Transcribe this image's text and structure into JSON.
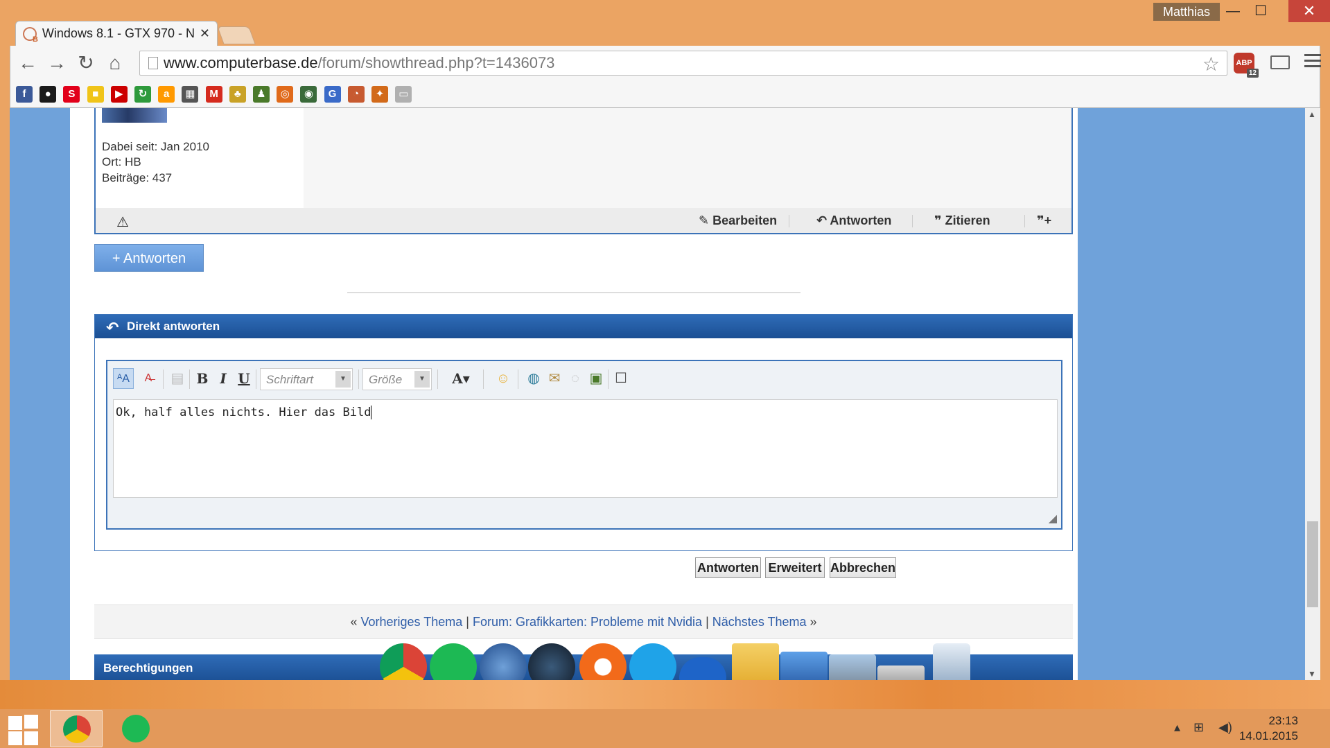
{
  "window": {
    "user": "Matthias",
    "minimize_glyph": "—",
    "maximize_glyph": "☐",
    "close_glyph": "✕"
  },
  "tab": {
    "title": "Windows 8.1 - GTX 970 - N",
    "close_glyph": "✕"
  },
  "address": {
    "host": "www.computerbase.de",
    "path": "/forum/showthread.php?t=1436073"
  },
  "extensions": {
    "abp_label": "ABP",
    "abp_count": "12"
  },
  "bookmarks": [
    {
      "icon": "facebook-icon",
      "glyph": "f",
      "color": "#3b5998"
    },
    {
      "icon": "tumblr-icon",
      "glyph": "●",
      "color": "#1a1a1a"
    },
    {
      "icon": "sparkasse-icon",
      "glyph": "S",
      "color": "#e2001a"
    },
    {
      "icon": "yellow-icon",
      "glyph": "■",
      "color": "#f0c419"
    },
    {
      "icon": "youtube-icon",
      "glyph": "▶",
      "color": "#cc0000"
    },
    {
      "icon": "recycle-icon",
      "glyph": "↻",
      "color": "#2e9a3c"
    },
    {
      "icon": "amazon-icon",
      "glyph": "a",
      "color": "#ff9900"
    },
    {
      "icon": "shop-icon",
      "glyph": "▦",
      "color": "#555555"
    },
    {
      "icon": "mydealz-icon",
      "glyph": "M",
      "color": "#d52b1e"
    },
    {
      "icon": "pineapple-icon",
      "glyph": "♣",
      "color": "#c9a227"
    },
    {
      "icon": "chess-icon",
      "glyph": "♟",
      "color": "#4a7a2a"
    },
    {
      "icon": "basketball-icon",
      "glyph": "◎",
      "color": "#e06a1a"
    },
    {
      "icon": "owl-icon",
      "glyph": "◉",
      "color": "#3a6a3a"
    },
    {
      "icon": "g-icon",
      "glyph": "G",
      "color": "#3a6ac8"
    },
    {
      "icon": "computerbase-icon",
      "glyph": "◔",
      "color": "#c75a30"
    },
    {
      "icon": "puzzle-icon",
      "glyph": "✦",
      "color": "#d26a1a"
    },
    {
      "icon": "slides-icon",
      "glyph": "▭",
      "color": "#b0b0b0"
    }
  ],
  "post": {
    "joined": "Dabei seit: Jan 2010",
    "location": "Ort: HB",
    "posts": "Beiträge: 437",
    "actions": {
      "edit": "Bearbeiten",
      "reply": "Antworten",
      "quote": "Zitieren"
    }
  },
  "reply_button": "+ Antworten",
  "quick_reply": {
    "title": "Direkt antworten",
    "font_placeholder": "Schriftart",
    "size_placeholder": "Größe",
    "text": "Ok, half alles nichts. Hier das Bild",
    "buttons": {
      "submit": "Antworten",
      "advanced": "Erweitert",
      "cancel": "Abbrechen"
    }
  },
  "thread_nav": {
    "prev_open": "«",
    "prev": "Vorheriges Thema",
    "sep1": "|",
    "forum": "Forum: Grafikkarten: Probleme mit Nvidia",
    "sep2": "|",
    "next": "Nächstes Thema",
    "next_close": "»"
  },
  "permissions": {
    "title": "Berechtigungen"
  },
  "dock": [
    {
      "icon": "chrome-icon"
    },
    {
      "icon": "spotify-icon"
    },
    {
      "icon": "thunderbird-icon"
    },
    {
      "icon": "steam-icon"
    },
    {
      "icon": "origin-icon"
    },
    {
      "icon": "skype-icon"
    },
    {
      "icon": "onedrive-icon"
    },
    {
      "icon": "downloads-folder-icon"
    },
    {
      "icon": "computer-icon"
    },
    {
      "icon": "windows-drive-icon"
    },
    {
      "icon": "drive-icon"
    },
    {
      "icon": "recycle-bin-icon"
    }
  ],
  "taskbar": {
    "time": "23:13",
    "date": "14.01.2015"
  }
}
